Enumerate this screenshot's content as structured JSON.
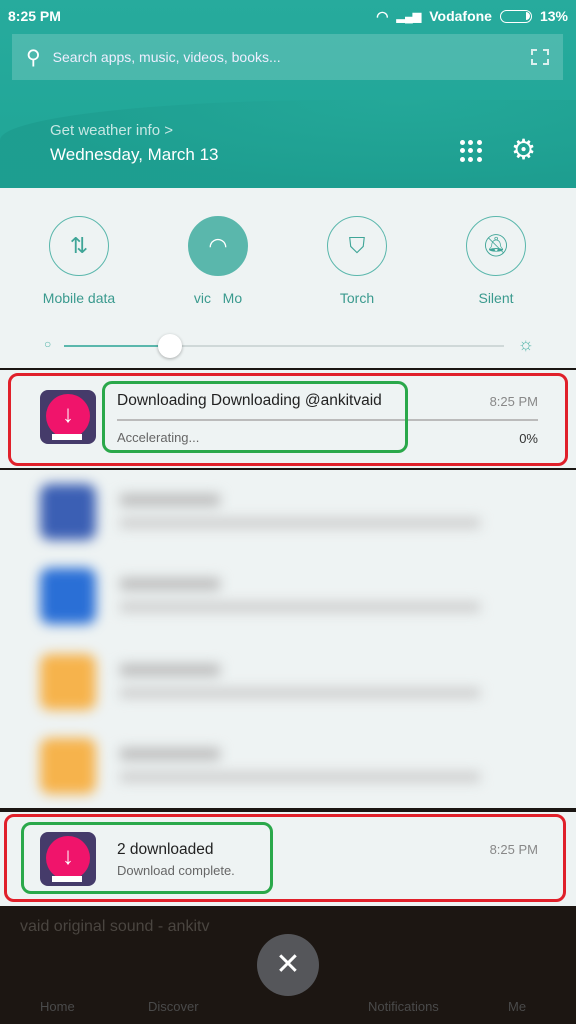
{
  "status_bar": {
    "time": "8:25 PM",
    "carrier": "Vodafone",
    "battery": "13%"
  },
  "search": {
    "placeholder": "Search apps, music, videos, books..."
  },
  "weather_link": "Get weather info >",
  "date": "Wednesday, March 13",
  "toggles": [
    {
      "label": "Mobile data",
      "icon": "data-arrows-icon",
      "on": false
    },
    {
      "label": "vic   Mo",
      "icon": "wifi-icon",
      "on": true
    },
    {
      "label": "Torch",
      "icon": "torch-icon",
      "on": false
    },
    {
      "label": "Silent",
      "icon": "bell-off-icon",
      "on": false
    }
  ],
  "brightness": 0.24,
  "notifications": [
    {
      "title": "Downloading Downloading @ankitvaid",
      "subtitle": "Accelerating...",
      "time": "8:25 PM",
      "progress": "0%"
    },
    {
      "title": "2 downloaded",
      "subtitle": "Download complete.",
      "time": "8:25 PM"
    }
  ],
  "background_app": {
    "music": "vaid   original sound - ankitv",
    "nav": [
      "Home",
      "Discover",
      "Notifications",
      "Me"
    ]
  },
  "colors": {
    "accent": "#27ab9d",
    "highlight_red": "#e0202a",
    "highlight_green": "#2aa84a"
  }
}
